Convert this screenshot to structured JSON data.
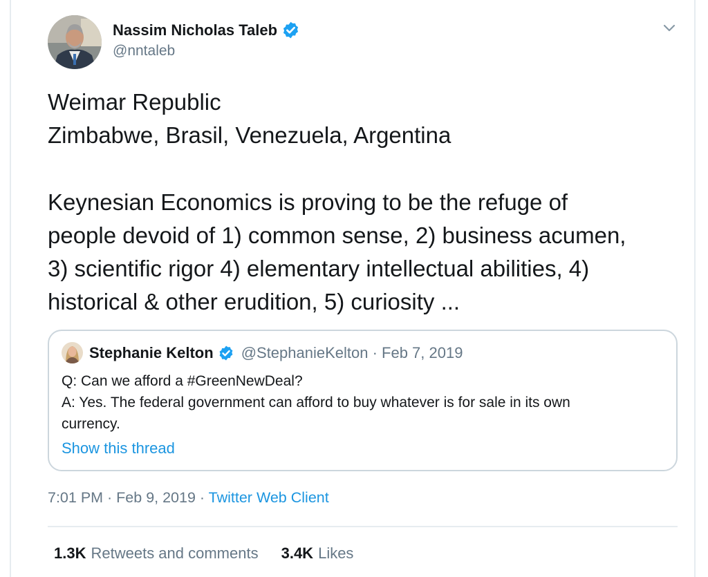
{
  "author": {
    "name": "Nassim Nicholas Taleb",
    "handle": "@nntaleb",
    "verified": true,
    "avatar_icon": "profile-photo"
  },
  "tweet": {
    "lines_block1": [
      "Weimar Republic",
      "Zimbabwe, Brasil, Venezuela, Argentina"
    ],
    "lines_block2": [
      "Keynesian Economics is proving to be the refuge of",
      "people devoid of 1) common sense,  2) business acumen,",
      "3) scientific rigor 4) elementary intellectual abilities, 4)",
      "historical & other erudition, 5) curiosity ..."
    ]
  },
  "quote": {
    "name": "Stephanie Kelton",
    "meta": "@StephanieKelton · Feb 7, 2019",
    "verified": true,
    "lines": [
      "Q: Can we afford a #GreenNewDeal?",
      "A: Yes. The federal government can afford to buy whatever is for sale in its own",
      "currency."
    ],
    "show_thread": "Show this thread"
  },
  "timestamp": {
    "time_date": "7:01 PM · Feb 9, 2019 · ",
    "client": "Twitter Web Client"
  },
  "stats": {
    "retweets_count": "1.3K",
    "retweets_label": "Retweets and comments",
    "likes_count": "3.4K",
    "likes_label": "Likes"
  },
  "colors": {
    "link": "#1b95e0",
    "secondary_text": "#657786",
    "primary_text": "#14171a",
    "verified_badge": "#1da1f2",
    "border": "#ccd6dd"
  },
  "icons": {
    "verified": "verified-badge-icon",
    "menu": "chevron-down-icon"
  }
}
